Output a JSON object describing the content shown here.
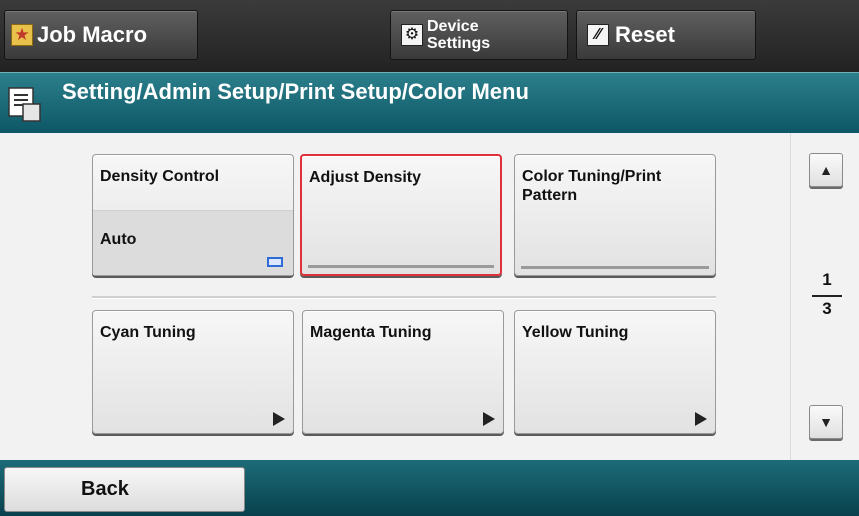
{
  "header": {
    "job_macro_label": "Job Macro",
    "device_settings_line1": "Device",
    "device_settings_line2": "Settings",
    "reset_label": "Reset"
  },
  "title": {
    "path": "Setting/Admin Setup/Print Setup/Color Menu"
  },
  "menu": {
    "tiles": [
      {
        "label": "Density Control",
        "value": "Auto"
      },
      {
        "label": "Adjust Density",
        "selected": true
      },
      {
        "label": "Color Tuning/Print Pattern"
      },
      {
        "label": "Cyan Tuning"
      },
      {
        "label": "Magenta Tuning"
      },
      {
        "label": "Yellow Tuning"
      }
    ]
  },
  "pager": {
    "current": "1",
    "total": "3"
  },
  "footer": {
    "back_label": "Back"
  },
  "colors": {
    "title_bar": "#0d5766",
    "selected_border": "#e0303a",
    "indicator": "#2f6bd6"
  }
}
